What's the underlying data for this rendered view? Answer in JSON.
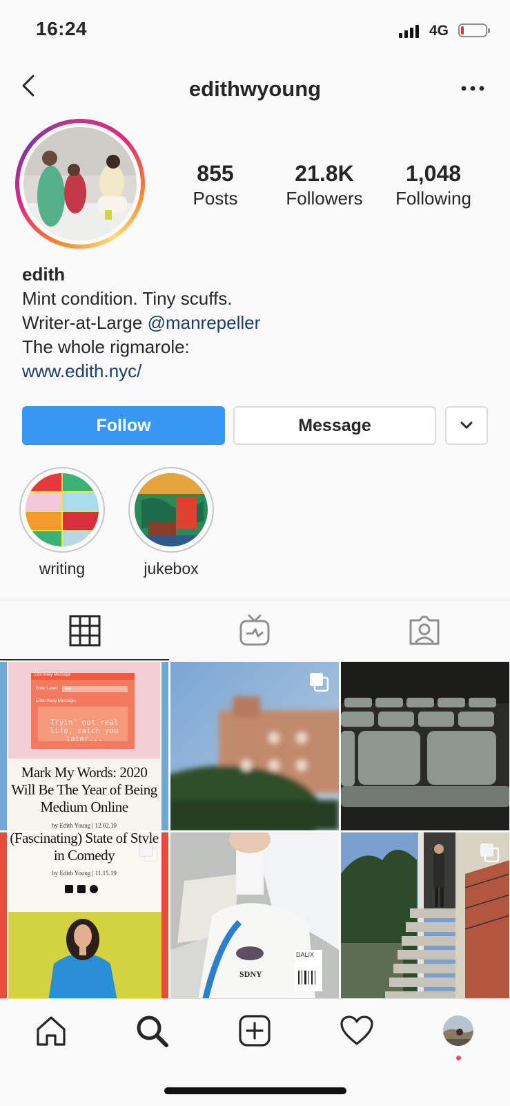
{
  "status_bar": {
    "time": "16:24",
    "network": "4G",
    "battery_color": "#e0352b"
  },
  "header": {
    "username": "edithwyoung",
    "back_icon": "chevron-left-icon",
    "more_icon": "ellipsis-icon"
  },
  "profile": {
    "stats": [
      {
        "value": "855",
        "label": "Posts"
      },
      {
        "value": "21.8K",
        "label": "Followers"
      },
      {
        "value": "1,048",
        "label": "Following"
      }
    ],
    "bio": {
      "name": "edith",
      "line1": "Mint condition. Tiny scuffs.",
      "line2_prefix": "Writer-at-Large ",
      "line2_mention": "@manrepeller",
      "line3": "The whole rigmarole:",
      "website": "www.edith.nyc/"
    }
  },
  "actions": {
    "follow": "Follow",
    "message": "Message",
    "more_icon": "chevron-down-icon"
  },
  "highlights": [
    {
      "label": "writing"
    },
    {
      "label": "jukebox"
    }
  ],
  "tabs": [
    {
      "icon": "grid-icon",
      "active": true
    },
    {
      "icon": "igtv-icon",
      "active": false
    },
    {
      "icon": "tagged-icon",
      "active": false
    }
  ],
  "posts": {
    "post1": {
      "dialog_title": "Edit Away Message",
      "field_label": "Enter Label:",
      "field_value": "edit",
      "message_label": "Enter Away Message:",
      "message_text": "Tryin' out real life, catch you later...",
      "headline": "Mark My Words: 2020 Will Be The Year of Being Medium Online",
      "byline": "by Edith Young",
      "date": "12.02.19"
    },
    "post4": {
      "headline": "(Fascinating) State of Style in Comedy",
      "byline": "by Edith Young",
      "date": "11.15.19"
    },
    "post5": {
      "bag_text": "SDNY",
      "tag_text": "DALIX"
    }
  },
  "bottom_nav": [
    {
      "icon": "home-icon"
    },
    {
      "icon": "search-icon"
    },
    {
      "icon": "new-post-icon"
    },
    {
      "icon": "heart-icon"
    },
    {
      "icon": "profile-avatar"
    }
  ],
  "colors": {
    "accent": "#3897f0",
    "link": "#1b3c6e",
    "notification_dot": "#ed4956"
  }
}
